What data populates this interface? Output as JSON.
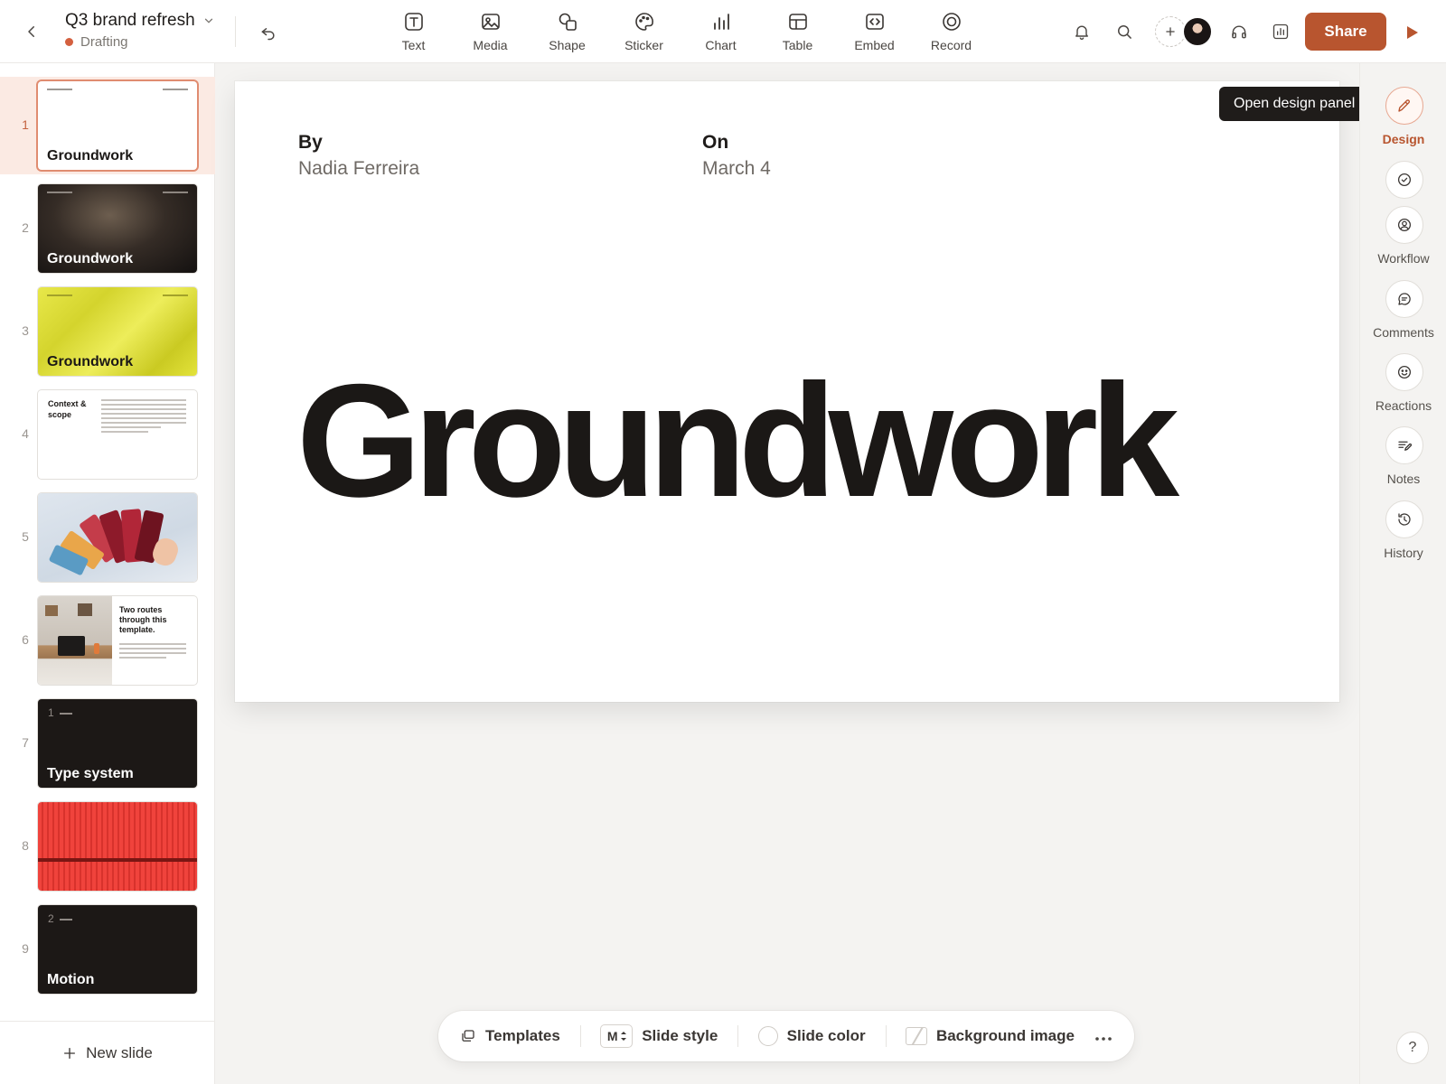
{
  "header": {
    "title": "Q3 brand refresh",
    "status": "Drafting",
    "tools": [
      {
        "label": "Text",
        "icon": "text-icon"
      },
      {
        "label": "Media",
        "icon": "media-icon"
      },
      {
        "label": "Shape",
        "icon": "shape-icon"
      },
      {
        "label": "Sticker",
        "icon": "sticker-icon"
      },
      {
        "label": "Chart",
        "icon": "chart-icon"
      },
      {
        "label": "Table",
        "icon": "table-icon"
      },
      {
        "label": "Embed",
        "icon": "embed-icon"
      },
      {
        "label": "Record",
        "icon": "record-icon"
      }
    ],
    "share_label": "Share"
  },
  "slides": [
    {
      "number": "1",
      "title": "Groundwork"
    },
    {
      "number": "2",
      "title": "Groundwork"
    },
    {
      "number": "3",
      "title": "Groundwork"
    },
    {
      "number": "4",
      "title": "Context & scope"
    },
    {
      "number": "5",
      "title": ""
    },
    {
      "number": "6",
      "title": "Two routes through this template."
    },
    {
      "number": "7",
      "title": "Type system",
      "index": "1"
    },
    {
      "number": "8",
      "title": ""
    },
    {
      "number": "9",
      "title": "Motion",
      "index": "2"
    }
  ],
  "new_slide_label": "New slide",
  "canvas": {
    "by_label": "By",
    "by_value": "Nadia Ferreira",
    "on_label": "On",
    "on_value": "March 4",
    "title": "Groundwork"
  },
  "tooltip": "Open design panel",
  "rail": [
    {
      "label": "Design",
      "icon": "pencil-icon"
    },
    {
      "label": "",
      "icon": "check-circle-icon"
    },
    {
      "label": "Workflow",
      "icon": "user-circle-icon"
    },
    {
      "label": "Comments",
      "icon": "comment-icon"
    },
    {
      "label": "Reactions",
      "icon": "smile-icon"
    },
    {
      "label": "Notes",
      "icon": "notes-icon"
    },
    {
      "label": "History",
      "icon": "history-icon"
    }
  ],
  "help_label": "?",
  "bottom_bar": {
    "templates_label": "Templates",
    "slide_style_label": "Slide style",
    "slide_style_badge": "M",
    "slide_color_label": "Slide color",
    "background_image_label": "Background image"
  },
  "colors": {
    "accent": "#b8552f",
    "status_dot": "#d4603f",
    "slide3_bg": "#e3e33b",
    "slide8_bg": "#f0433c"
  }
}
